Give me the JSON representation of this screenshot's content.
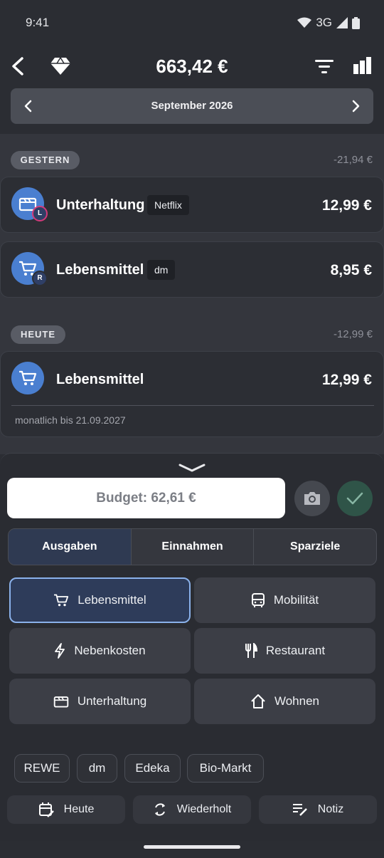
{
  "status": {
    "time": "9:41",
    "network": "3G"
  },
  "header": {
    "total": "663,42 €",
    "month": "September 2026"
  },
  "groups": [
    {
      "label": "GESTERN",
      "sum": "-21,94 €",
      "items": [
        {
          "category": "Unterhaltung",
          "tag": "Netflix",
          "amount": "12,99 €",
          "badge": "L"
        },
        {
          "category": "Lebensmittel",
          "tag": "dm",
          "amount": "8,95 €",
          "badge": "R"
        }
      ]
    },
    {
      "label": "HEUTE",
      "sum": "-12,99 €",
      "items": [
        {
          "category": "Lebensmittel",
          "amount": "12,99 €",
          "recurrence": "monatlich bis 21.09.2027"
        }
      ]
    }
  ],
  "sheet": {
    "budget": "Budget: 62,61 €",
    "tabs": [
      "Ausgaben",
      "Einnahmen",
      "Sparziele"
    ],
    "categories": [
      {
        "label": "Lebensmittel",
        "icon": "cart-icon"
      },
      {
        "label": "Mobilität",
        "icon": "bus-icon"
      },
      {
        "label": "Nebenkosten",
        "icon": "bolt-icon"
      },
      {
        "label": "Restaurant",
        "icon": "fork-knife-icon"
      },
      {
        "label": "Unterhaltung",
        "icon": "clapperboard-icon"
      },
      {
        "label": "Wohnen",
        "icon": "house-icon"
      }
    ],
    "shops": [
      "REWE",
      "dm",
      "Edeka",
      "Bio-Markt"
    ],
    "actions": [
      {
        "label": "Heute",
        "icon": "calendar-edit-icon"
      },
      {
        "label": "Wiederholt",
        "icon": "repeat-icon"
      },
      {
        "label": "Notiz",
        "icon": "note-edit-icon"
      }
    ]
  },
  "colors": {
    "accent": "#4a7fd0",
    "selected_border": "#8ab1ea",
    "confirm": "#2f5448"
  }
}
